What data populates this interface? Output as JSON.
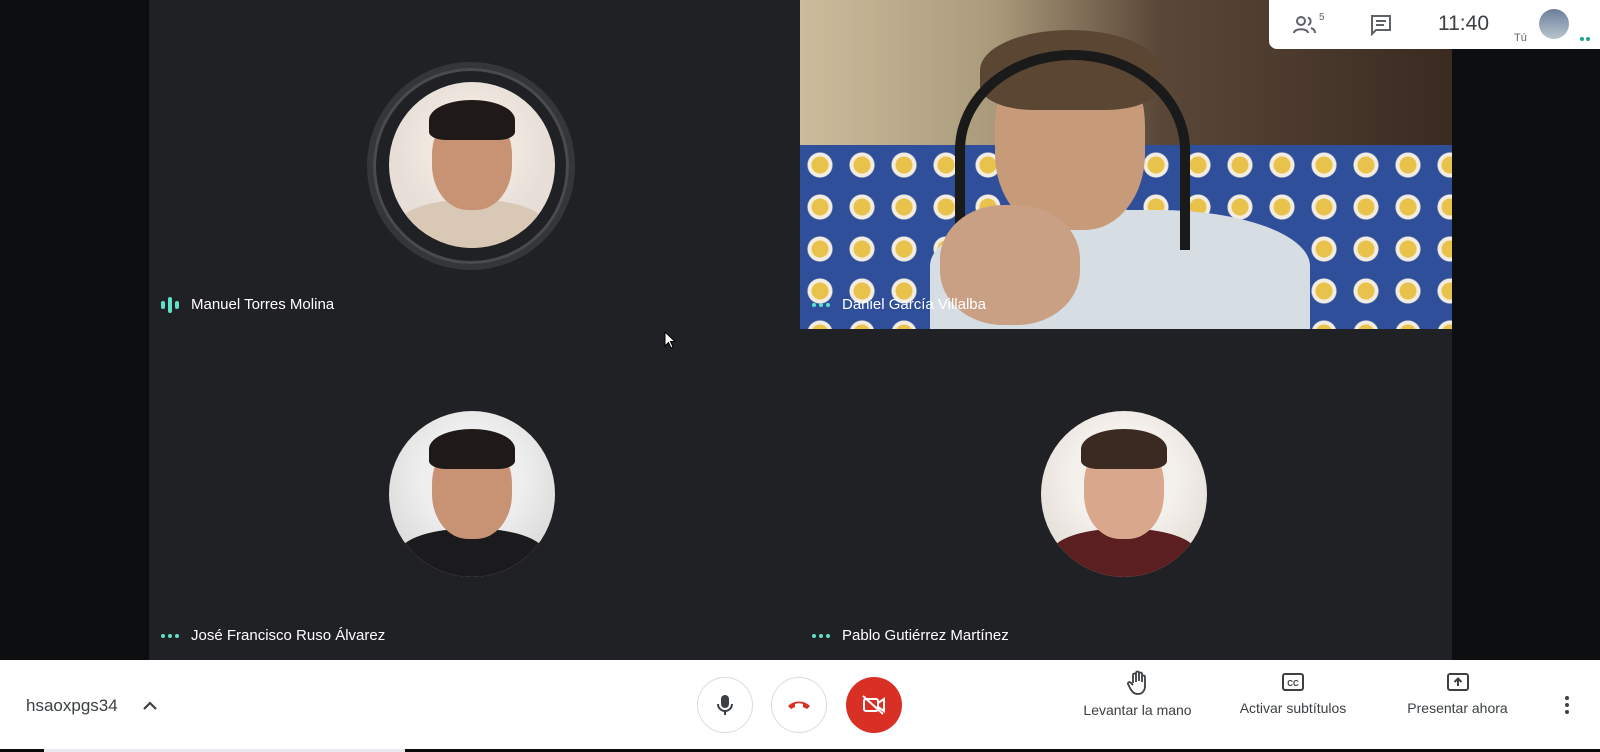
{
  "header": {
    "participants_count": "5",
    "time": "11:40",
    "self_label": "Tú"
  },
  "participants": [
    {
      "name": "Manuel Torres Molina",
      "status": "speaking"
    },
    {
      "name": "Daniel García Villalba",
      "status": "idle"
    },
    {
      "name": "José Francisco Ruso Álvarez",
      "status": "idle"
    },
    {
      "name": "Pablo Gutiérrez Martínez",
      "status": "idle"
    }
  ],
  "footer": {
    "meeting_code": "hsaoxpgs34",
    "actions": {
      "raise_hand": "Levantar la mano",
      "captions": "Activar subtítulos",
      "present": "Presentar ahora"
    }
  },
  "colors": {
    "end_call_red": "#d93025",
    "tile_bg": "#202124",
    "active_indicator": "#5fe0c8"
  },
  "icons": [
    "people-icon",
    "chat-icon",
    "mic-icon",
    "end-call-icon",
    "camera-off-icon",
    "hand-icon",
    "cc-icon",
    "present-icon",
    "more-vert-icon",
    "chevron-up-icon"
  ]
}
